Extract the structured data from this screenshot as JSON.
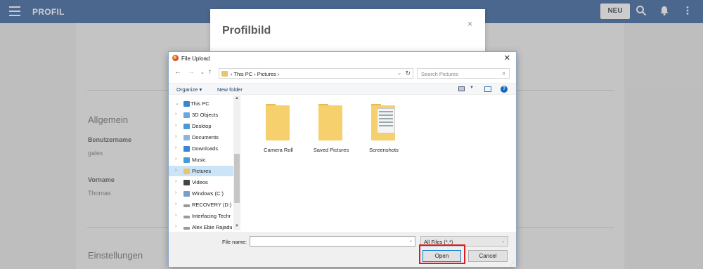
{
  "app": {
    "title": "PROFIL",
    "new_button": "NEU",
    "sections": [
      {
        "title": "Allgemein"
      },
      {
        "title": "Einstellungen"
      }
    ],
    "fields": [
      {
        "label": "Benutzername",
        "value": "galex"
      },
      {
        "label": "Vorname",
        "value": "Thomas"
      }
    ]
  },
  "modal": {
    "title": "Profilbild",
    "close": "×"
  },
  "dialog": {
    "title": "File Upload",
    "close": "✕",
    "address": "› This PC › Pictures ›",
    "search_placeholder": "Search Pictures",
    "toolbar": {
      "organize": "Organize ▾",
      "new_folder": "New folder"
    },
    "tree": [
      {
        "label": "This PC",
        "arrow": "⌄",
        "icon_color": "#3a86d4",
        "icon": "pc-icon"
      },
      {
        "label": "3D Objects",
        "arrow": "›",
        "icon_color": "#6aa6e0",
        "icon": "3d-objects-icon"
      },
      {
        "label": "Desktop",
        "arrow": "›",
        "icon_color": "#4a9ad8",
        "icon": "desktop-icon"
      },
      {
        "label": "Documents",
        "arrow": "›",
        "icon_color": "#8fb4d8",
        "icon": "documents-icon"
      },
      {
        "label": "Downloads",
        "arrow": "›",
        "icon_color": "#3a86d4",
        "icon": "downloads-icon"
      },
      {
        "label": "Music",
        "arrow": "›",
        "icon_color": "#4a9ad8",
        "icon": "music-icon"
      },
      {
        "label": "Pictures",
        "arrow": "›",
        "icon_color": "#e9c46a",
        "icon": "pictures-icon",
        "selected": true
      },
      {
        "label": "Videos",
        "arrow": "›",
        "icon_color": "#444",
        "icon": "videos-icon"
      },
      {
        "label": "Windows (C:)",
        "arrow": "›",
        "icon_color": "#7a9ccc",
        "icon": "drive-icon"
      },
      {
        "label": "RECOVERY (D:)",
        "arrow": "›",
        "icon_color": "#999",
        "icon": "drive-icon"
      },
      {
        "label": "Interfacing Techr",
        "arrow": "›",
        "icon_color": "#999",
        "icon": "drive-icon"
      },
      {
        "label": "Alex Ebie Rajadu",
        "arrow": "›",
        "icon_color": "#999",
        "icon": "drive-icon"
      }
    ],
    "folders": [
      {
        "name": "Camera Roll"
      },
      {
        "name": "Saved Pictures"
      },
      {
        "name": "Screenshots"
      }
    ],
    "file_name_label": "File name:",
    "file_name_value": "",
    "file_type": "All Files (*.*)",
    "open_button": "Open",
    "cancel_button": "Cancel"
  }
}
